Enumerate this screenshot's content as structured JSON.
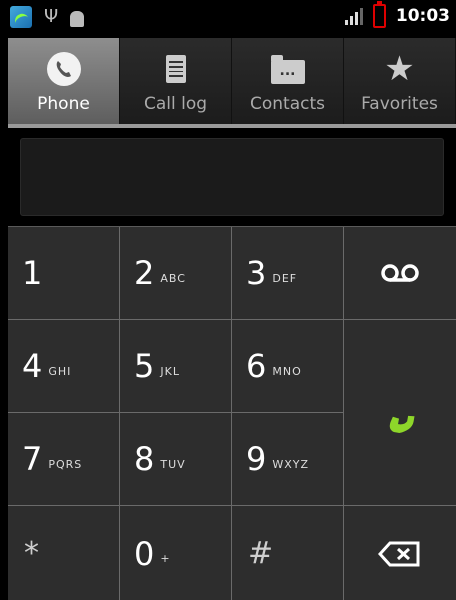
{
  "status_bar": {
    "time": "10:03",
    "icons": [
      "app-notification-icon",
      "usb-icon",
      "android-debug-icon",
      "signal-icon",
      "battery-low-icon"
    ]
  },
  "tabs": [
    {
      "label": "Phone",
      "icon": "phone-icon",
      "active": true
    },
    {
      "label": "Call log",
      "icon": "call-log-icon",
      "active": false
    },
    {
      "label": "Contacts",
      "icon": "contacts-folder-icon",
      "active": false
    },
    {
      "label": "Favorites",
      "icon": "star-icon",
      "active": false
    }
  ],
  "display": {
    "value": ""
  },
  "keypad": {
    "keys": [
      {
        "digit": "1",
        "letters": ""
      },
      {
        "digit": "2",
        "letters": "ABC"
      },
      {
        "digit": "3",
        "letters": "DEF"
      },
      {
        "digit": "4",
        "letters": "GHI"
      },
      {
        "digit": "5",
        "letters": "JKL"
      },
      {
        "digit": "6",
        "letters": "MNO"
      },
      {
        "digit": "7",
        "letters": "PQRS"
      },
      {
        "digit": "8",
        "letters": "TUV"
      },
      {
        "digit": "9",
        "letters": "WXYZ"
      },
      {
        "digit": "*",
        "letters": ""
      },
      {
        "digit": "0",
        "letters": "+"
      },
      {
        "digit": "#",
        "letters": ""
      }
    ],
    "side_icons": [
      "voicemail-icon",
      "call-icon",
      "delete-icon"
    ],
    "colors": {
      "call": "#8ed62a",
      "panel": "#2d2d2d",
      "divider": "#6a6a6a"
    }
  }
}
